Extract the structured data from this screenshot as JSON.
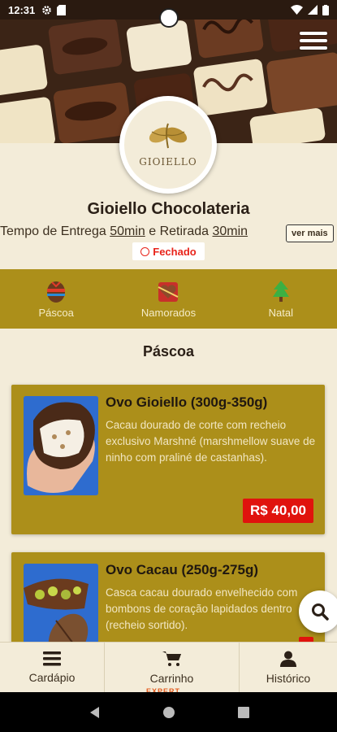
{
  "status_bar": {
    "time": "12:31"
  },
  "store": {
    "logo_text": "GIOIELLO",
    "name": "Gioiello Chocolateria",
    "delivery_prefix": "Tempo de Entrega ",
    "delivery_time": "50min",
    "pickup_prefix": " e Retirada ",
    "pickup_time": "30min",
    "more_label": "ver mais",
    "status_label": "Fechado"
  },
  "categories": [
    {
      "label": "Páscoa",
      "icon": "easter-egg-icon"
    },
    {
      "label": "Namorados",
      "icon": "heart-box-icon"
    },
    {
      "label": "Natal",
      "icon": "christmas-tree-icon"
    }
  ],
  "section_title": "Páscoa",
  "products": [
    {
      "name": "Ovo Gioiello (300g-350g)",
      "description": "Cacau dourado de corte com recheio exclusivo Marshné (marshmellow suave de ninho com praliné de castanhas).",
      "price": "R$ 40,00"
    },
    {
      "name": "Ovo Cacau (250g-275g)",
      "description": "Casca cacau dourado envelhecido com bombons de coração lapidados dentro (recheio sortido).",
      "price": ""
    }
  ],
  "bottom_nav": [
    {
      "label": "Cardápio",
      "icon": "menu-list-icon"
    },
    {
      "label": "Carrinho",
      "icon": "cart-icon"
    },
    {
      "label": "Histórico",
      "icon": "user-icon"
    }
  ],
  "peek_text": "EXPERT",
  "colors": {
    "background": "#f3ecd9",
    "accent_gold": "#ac8f1a",
    "price_red": "#e0130d",
    "closed_red": "#e8241b"
  }
}
